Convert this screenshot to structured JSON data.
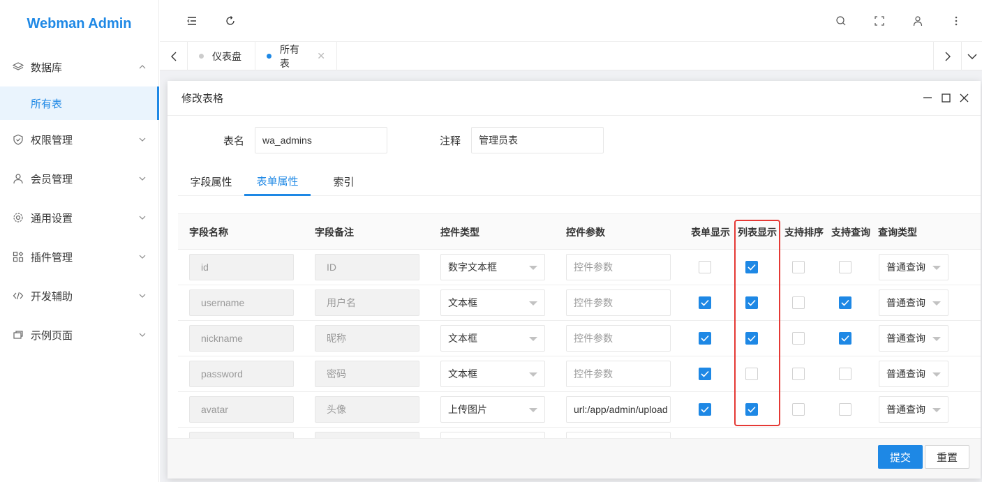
{
  "app": {
    "logo": "Webman Admin"
  },
  "sidebar": {
    "items": [
      {
        "label": "数据库",
        "icon": "layers-icon",
        "expanded": true
      },
      {
        "label": "权限管理",
        "icon": "shield-icon"
      },
      {
        "label": "会员管理",
        "icon": "user-icon"
      },
      {
        "label": "通用设置",
        "icon": "gear-icon"
      },
      {
        "label": "插件管理",
        "icon": "plugin-icon"
      },
      {
        "label": "开发辅助",
        "icon": "code-icon"
      },
      {
        "label": "示例页面",
        "icon": "page-icon"
      }
    ],
    "sub_item": "所有表"
  },
  "tabs": [
    {
      "label": "仪表盘",
      "active": false
    },
    {
      "label": "所有表",
      "active": true
    }
  ],
  "modal": {
    "title": "修改表格",
    "table_name_label": "表名",
    "table_name_value": "wa_admins",
    "comment_label": "注释",
    "comment_value": "管理员表",
    "tabs": [
      "字段属性",
      "表单属性",
      "索引"
    ],
    "active_tab": "表单属性",
    "columns": [
      "字段名称",
      "字段备注",
      "控件类型",
      "控件参数",
      "表单显示",
      "列表显示",
      "支持排序",
      "支持查询",
      "查询类型"
    ],
    "rows": [
      {
        "field": "id",
        "remark": "ID",
        "control": "数字文本框",
        "param": "",
        "form_show": false,
        "list_show": true,
        "sortable": false,
        "searchable": false,
        "query_type": "普通查询"
      },
      {
        "field": "username",
        "remark": "用户名",
        "control": "文本框",
        "param": "",
        "form_show": true,
        "list_show": true,
        "sortable": false,
        "searchable": true,
        "query_type": "普通查询"
      },
      {
        "field": "nickname",
        "remark": "昵称",
        "control": "文本框",
        "param": "",
        "form_show": true,
        "list_show": true,
        "sortable": false,
        "searchable": true,
        "query_type": "普通查询"
      },
      {
        "field": "password",
        "remark": "密码",
        "control": "文本框",
        "param": "",
        "form_show": true,
        "list_show": false,
        "sortable": false,
        "searchable": false,
        "query_type": "普通查询"
      },
      {
        "field": "avatar",
        "remark": "头像",
        "control": "上传图片",
        "param": "url:/app/admin/upload",
        "form_show": true,
        "list_show": true,
        "sortable": false,
        "searchable": false,
        "query_type": "普通查询"
      }
    ],
    "param_placeholder": "控件参数",
    "submit_label": "提交",
    "reset_label": "重置"
  },
  "colors": {
    "accent": "#1e88e5",
    "highlight": "#e53935"
  }
}
